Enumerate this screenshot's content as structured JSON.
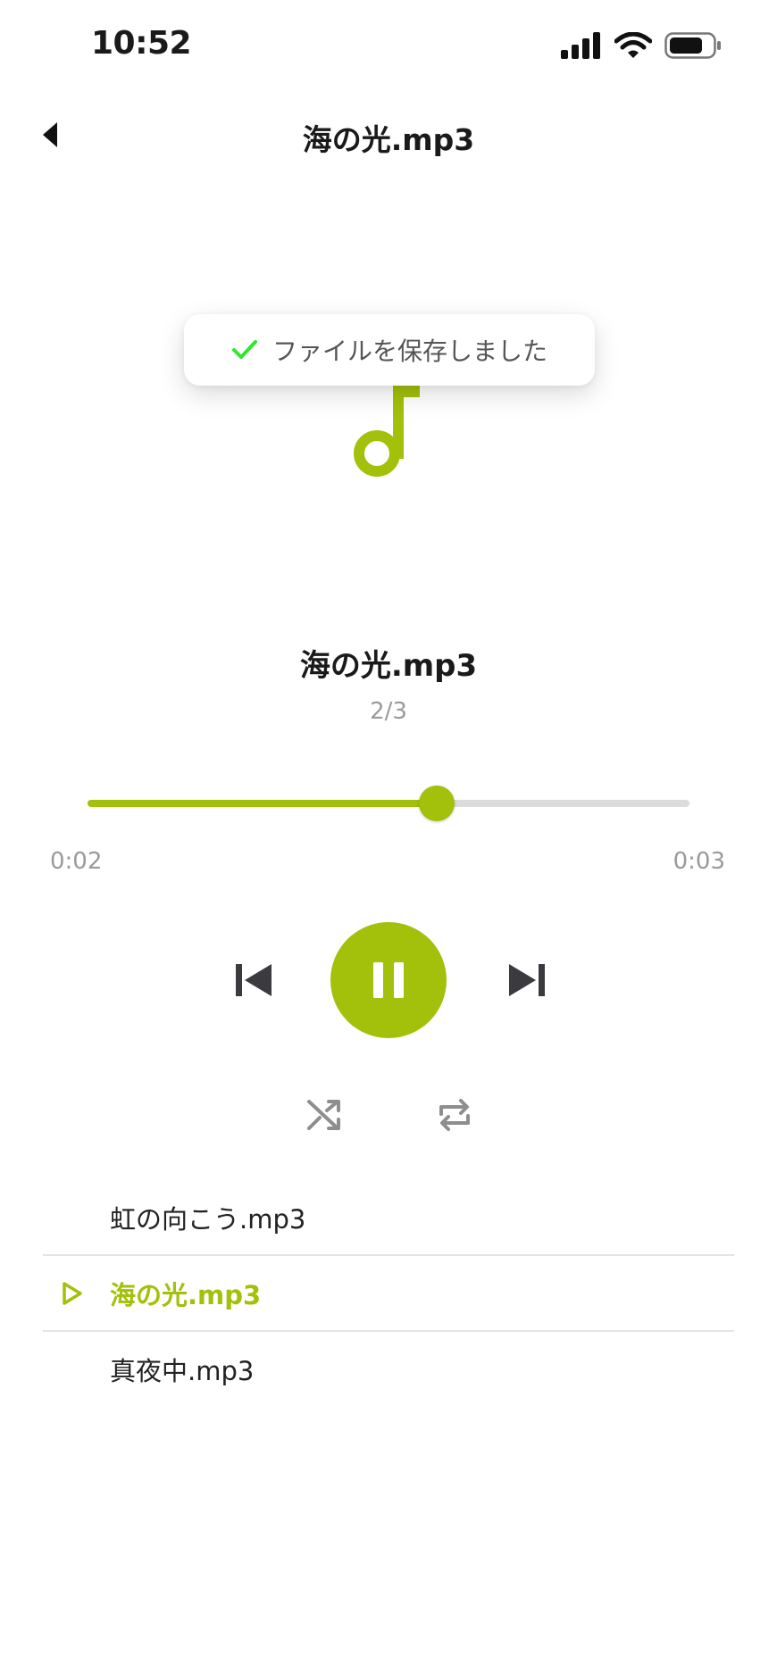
{
  "status_bar": {
    "time": "10:52"
  },
  "nav": {
    "title": "海の光.mp3"
  },
  "toast": {
    "message": "ファイルを保存しました"
  },
  "player": {
    "title": "海の光.mp3",
    "index": "2/3",
    "elapsed": "0:02",
    "total": "0:03",
    "progress": 0.58,
    "state": "playing"
  },
  "playlist": {
    "items": [
      {
        "label": "虹の向こう.mp3",
        "active": false
      },
      {
        "label": "海の光.mp3",
        "active": true
      },
      {
        "label": "真夜中.mp3",
        "active": false
      }
    ]
  },
  "colors": {
    "accent": "#a3c00a",
    "toast_check": "#2ee82e",
    "control_dark": "#3a3a3f",
    "control_gray": "#8e8e8e",
    "track_inactive": "#dcdcdc"
  },
  "icons": {
    "back": "chevron-left-icon",
    "note": "music-note-icon",
    "prev": "skip-previous-icon",
    "pause": "pause-icon",
    "next": "skip-next-icon",
    "shuffle": "shuffle-icon",
    "repeat": "repeat-icon",
    "now_playing": "play-outline-icon"
  }
}
